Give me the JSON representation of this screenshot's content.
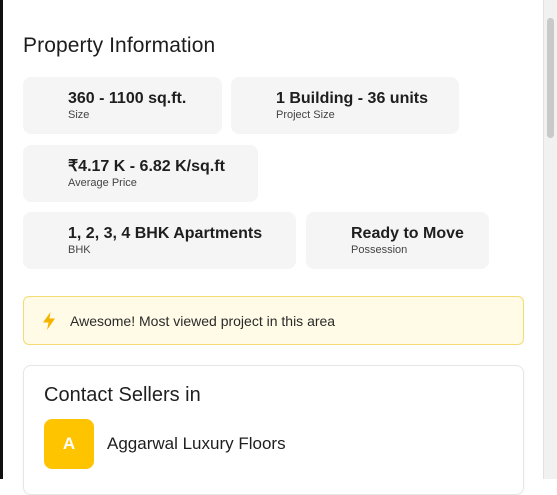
{
  "section": {
    "title": "Property Information"
  },
  "cards": [
    {
      "value": "360 - 1100 sq.ft.",
      "label": "Size"
    },
    {
      "value": "1 Building - 36 units",
      "label": "Project Size"
    },
    {
      "value": "₹4.17 K - 6.82 K/sq.ft",
      "label": "Average Price"
    },
    {
      "value": "1, 2, 3, 4 BHK Apartments",
      "label": "BHK"
    },
    {
      "value": "Ready to Move",
      "label": "Possession"
    }
  ],
  "banner": {
    "icon": "lightning-icon",
    "text": "Awesome! Most viewed project in this area",
    "accent": "#f5b400"
  },
  "contact": {
    "heading": "Contact Sellers in",
    "seller": {
      "initial": "A",
      "name": "Aggarwal Luxury Floors",
      "avatar_color": "#ffc400"
    }
  }
}
